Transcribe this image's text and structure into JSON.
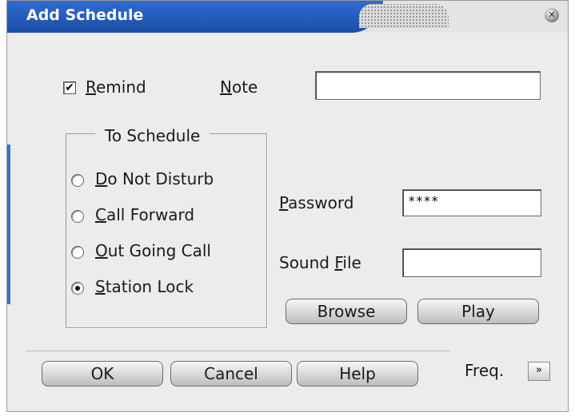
{
  "window": {
    "title": "Add Schedule",
    "close_icon": "close-icon"
  },
  "remind": {
    "checked": true,
    "label_ul": "R",
    "label_rest": "emind"
  },
  "note": {
    "label_ul": "N",
    "label_rest": "ote",
    "value": ""
  },
  "schedule_group": {
    "title": "To Schedule",
    "options": [
      {
        "ul": "D",
        "rest": "o Not Disturb",
        "selected": false
      },
      {
        "ul": "C",
        "rest": "all Forward",
        "selected": false
      },
      {
        "ul": "O",
        "rest": "ut Going Call",
        "selected": false
      },
      {
        "ul": "S",
        "rest": "tation Lock",
        "selected": true
      }
    ]
  },
  "password": {
    "label_ul": "P",
    "label_rest": "assword",
    "value": "****"
  },
  "sound_file": {
    "label_pre": "Sound ",
    "label_ul": "F",
    "label_rest": "ile",
    "value": ""
  },
  "buttons": {
    "browse": "Browse",
    "play": "Play",
    "ok": "OK",
    "cancel": "Cancel",
    "help": "Help"
  },
  "freq": {
    "label": "Freq.",
    "toggle": "»"
  },
  "colors": {
    "title_bar": "#1f56b6",
    "dialog_bg": "#ececec"
  }
}
